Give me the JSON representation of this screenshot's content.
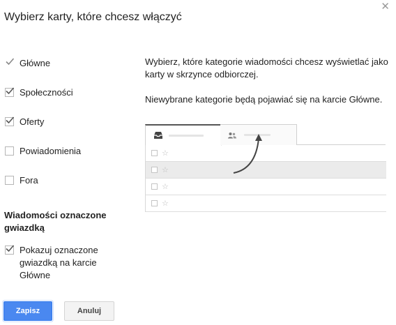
{
  "dialog": {
    "title": "Wybierz karty, które chcesz włączyć"
  },
  "categories": [
    {
      "label": "Główne",
      "checked": true,
      "locked": true
    },
    {
      "label": "Społeczności",
      "checked": true,
      "locked": false
    },
    {
      "label": "Oferty",
      "checked": true,
      "locked": false
    },
    {
      "label": "Powiadomienia",
      "checked": false,
      "locked": false
    },
    {
      "label": "Fora",
      "checked": false,
      "locked": false
    }
  ],
  "starred": {
    "heading": "Wiadomości oznaczone gwiazdką",
    "option_label": "Pokazuj oznaczone gwiazdką na karcie Główne",
    "checked": true
  },
  "explanation": {
    "paragraph1": "Wybierz, które kategorie wiadomości chcesz wyświetlać jako karty w skrzynce odbiorczej.",
    "paragraph2": "Niewybrane kategorie będą pojawiać się na karcie Główne."
  },
  "illustration": {
    "tab_icons": [
      "inbox-icon",
      "people-icon"
    ],
    "row_count": 4,
    "selected_row": 1,
    "star_glyph": "☆"
  },
  "buttons": {
    "save_label": "Zapisz",
    "cancel_label": "Anuluj"
  },
  "colors": {
    "accent": "#4a88f0",
    "check": "#555555"
  }
}
